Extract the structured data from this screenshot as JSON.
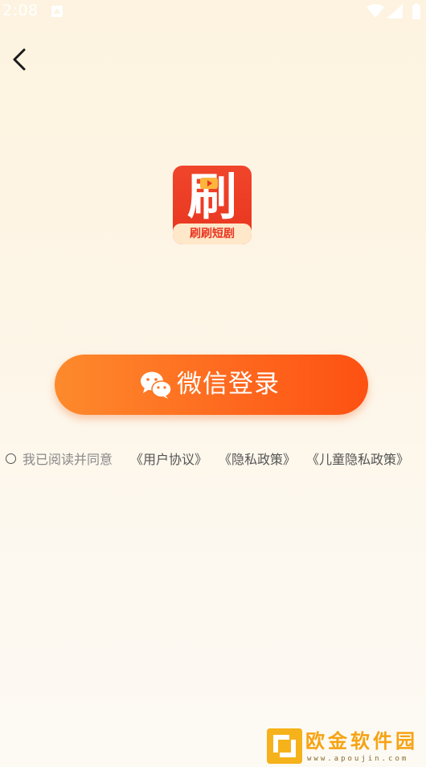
{
  "status_bar": {
    "time": "2:08",
    "icons": [
      "notification-icon",
      "wifi-icon",
      "signal-icon",
      "battery-icon"
    ]
  },
  "nav": {
    "back_icon": "chevron-left-icon"
  },
  "logo": {
    "char": "刷",
    "name": "刷刷短剧",
    "colors": {
      "background": "#e8351f",
      "band": "#ffe7c9"
    }
  },
  "login": {
    "button_label": "微信登录",
    "icon": "wechat-icon",
    "colors": {
      "gradient_start": "#fd8a2c",
      "gradient_end": "#fd5112",
      "text": "#ffffff"
    }
  },
  "agreement": {
    "checked": false,
    "text": "我已阅读并同意",
    "links": [
      "《用户协议》",
      "《隐私政策》",
      "《儿童隐私政策》"
    ]
  },
  "watermark": {
    "name": "欧金软件园",
    "url": "www.apoujin.com"
  }
}
